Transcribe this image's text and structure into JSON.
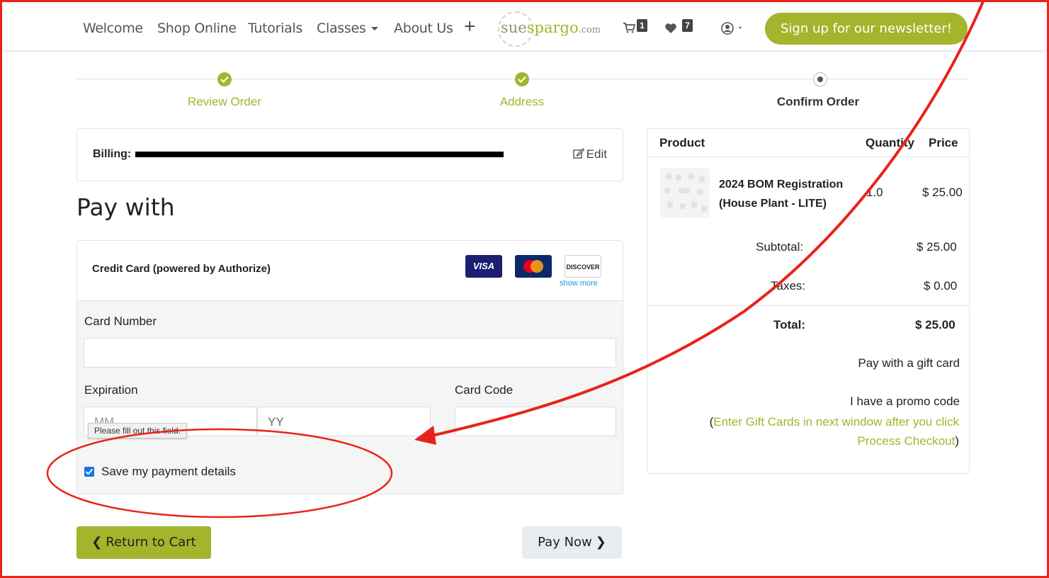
{
  "nav": {
    "items": [
      "Welcome",
      "Shop Online",
      "Tutorials",
      "Classes",
      "About Us"
    ],
    "plus_symbol": "+",
    "logo": {
      "part1": "sue",
      "part2": "spargo",
      "part3": ".com"
    },
    "cart_count": "1",
    "wishlist_count": "7",
    "newsletter_label": "Sign up for our newsletter!"
  },
  "progress": {
    "steps": [
      "Review Order",
      "Address",
      "Confirm Order"
    ],
    "current_step": 3
  },
  "billing": {
    "label": "Billing:",
    "edit_label": "Edit"
  },
  "payment": {
    "heading": "Pay with",
    "method_title": "Credit Card (powered by Authorize)",
    "card_brands": [
      "VISA",
      "MasterCard",
      "DISCOVER"
    ],
    "show_more_label": "show more",
    "card_number_label": "Card Number",
    "expiration_label": "Expiration",
    "card_code_label": "Card Code",
    "month_placeholder": "MM",
    "year_placeholder": "YY",
    "validation_tooltip": "Please fill out this field.",
    "save_payment_label": "Save my payment details",
    "save_payment_checked": true
  },
  "actions": {
    "return_label": "Return to Cart",
    "pay_label": "Pay Now"
  },
  "summary": {
    "headers": {
      "product": "Product",
      "quantity": "Quantity",
      "price": "Price"
    },
    "items": [
      {
        "name": "2024 BOM Registration (House Plant - LITE)",
        "quantity": "1.0",
        "price": "$ 25.00"
      }
    ],
    "subtotal_label": "Subtotal:",
    "subtotal_value": "$ 25.00",
    "taxes_label": "Taxes:",
    "taxes_value": "$ 0.00",
    "total_label": "Total:",
    "total_value": "$ 25.00",
    "gift_card_label": "Pay with a gift card",
    "promo_label": "I have a promo code",
    "gift_note_open": "(",
    "gift_note_link": "Enter Gift Cards in next window after you click Process Checkout",
    "gift_note_close": ")"
  },
  "colors": {
    "accent": "#a2b52d",
    "annotation": "#e8231a",
    "link": "#1a9ad6"
  }
}
